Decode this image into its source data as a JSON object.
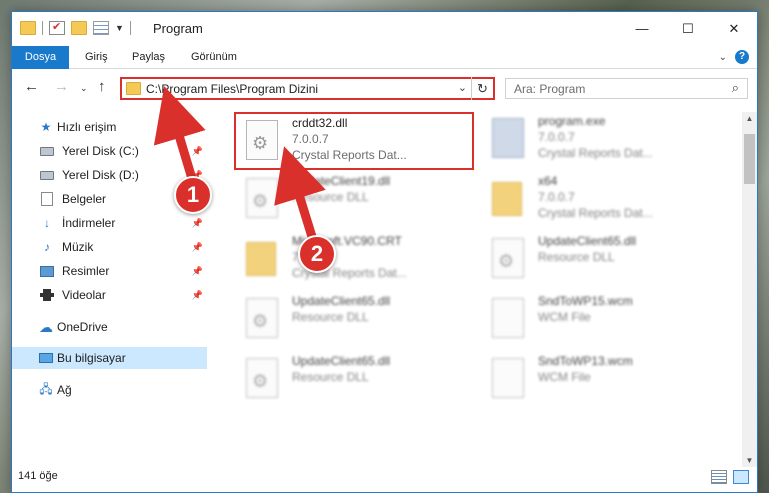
{
  "window": {
    "title": "Program",
    "minimize_icon": "minimize-icon",
    "maximize_icon": "maximize-icon",
    "close_icon": "close-icon"
  },
  "ribbon": {
    "tabs": [
      "Dosya",
      "Giriş",
      "Paylaş",
      "Görünüm"
    ],
    "help_label": "?"
  },
  "nav": {
    "address": "C:\\Program Files\\Program Dizini",
    "search_placeholder": "Ara: Program"
  },
  "sidebar": {
    "items": [
      {
        "label": "Hızlı erişim",
        "icon": "star-icon"
      },
      {
        "label": "Yerel Disk (C:)",
        "icon": "disk-icon",
        "pinned": true
      },
      {
        "label": "Yerel Disk (D:)",
        "icon": "disk-icon",
        "pinned": true
      },
      {
        "label": "Belgeler",
        "icon": "documents-icon",
        "pinned": true
      },
      {
        "label": "İndirmeler",
        "icon": "download-icon",
        "pinned": true
      },
      {
        "label": "Müzik",
        "icon": "music-icon",
        "pinned": true
      },
      {
        "label": "Resimler",
        "icon": "pictures-icon",
        "pinned": true
      },
      {
        "label": "Videolar",
        "icon": "videos-icon",
        "pinned": true
      },
      {
        "label": "OneDrive",
        "icon": "cloud-icon"
      },
      {
        "label": "Bu bilgisayar",
        "icon": "computer-icon",
        "selected": true
      },
      {
        "label": "Ağ",
        "icon": "network-icon"
      }
    ]
  },
  "files": [
    {
      "name": "crddt32.dll",
      "line1": "7.0.0.7",
      "line2": "Crystal Reports Dat...",
      "icon": "dll-icon"
    },
    {
      "name": "program.exe",
      "line1": "7.0.0.7",
      "line2": "Crystal Reports Dat...",
      "icon": "exe-icon"
    },
    {
      "name": "UpdateClient19.dll",
      "line1": "Resource DLL",
      "line2": "",
      "icon": "dll-icon"
    },
    {
      "name": "x64",
      "line1": "7.0.0.7",
      "line2": "Crystal Reports Dat...",
      "icon": "folder-icon"
    },
    {
      "name": "Microsoft.VC90.CRT",
      "line1": "7.0.0.7",
      "line2": "Crystal Reports Dat...",
      "icon": "folder-icon"
    },
    {
      "name": "UpdateClient65.dll",
      "line1": "Resource DLL",
      "line2": "",
      "icon": "dll-icon"
    },
    {
      "name": "UpdateClient65.dll",
      "line1": "Resource DLL",
      "line2": "",
      "icon": "dll-icon"
    },
    {
      "name": "SndToWP15.wcm",
      "line1": "WCM File",
      "line2": "",
      "icon": "file-icon"
    },
    {
      "name": "UpdateClient65.dll",
      "line1": "Resource DLL",
      "line2": "",
      "icon": "dll-icon"
    },
    {
      "name": "SndToWP13.wcm",
      "line1": "WCM File",
      "line2": "",
      "icon": "file-icon"
    }
  ],
  "status": {
    "item_count": "141 öğe"
  },
  "annotations": {
    "marker1": "1",
    "marker2": "2",
    "color": "#d9302c"
  }
}
